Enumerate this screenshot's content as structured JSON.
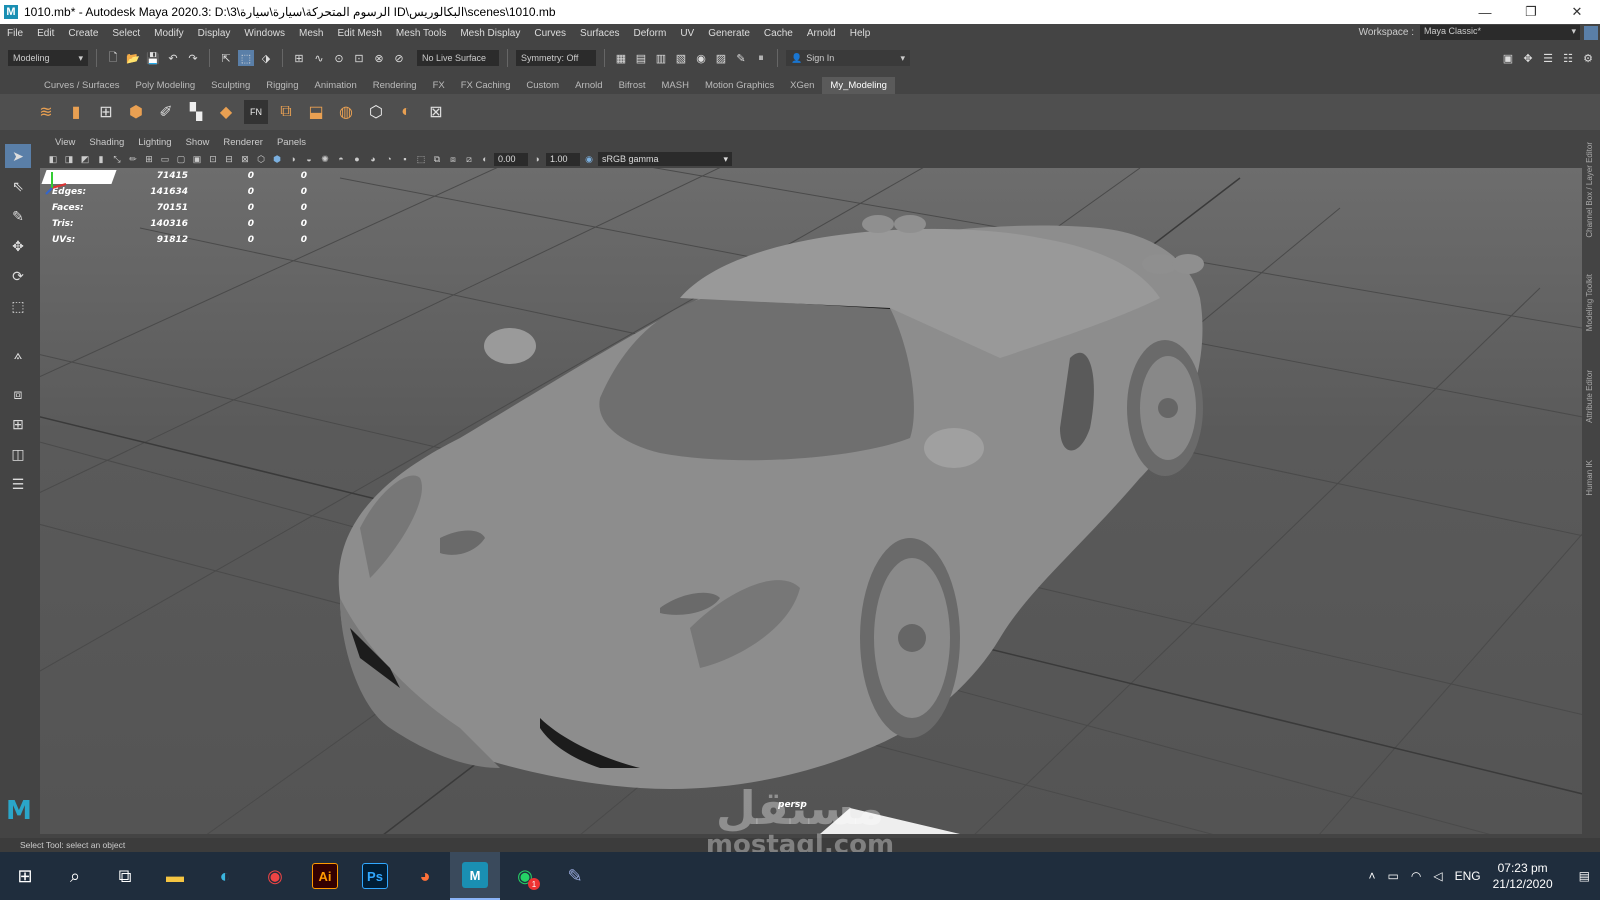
{
  "window": {
    "title": "1010.mb* - Autodesk Maya 2020.3: D:\\3\\الرسوم المتحركة\\سيارة\\سيارة ID\\البكالوريس\\scenes\\1010.mb",
    "logo": "M",
    "minimize": "—",
    "maximize": "❐",
    "close": "✕"
  },
  "menubar": {
    "items": [
      "File",
      "Edit",
      "Create",
      "Select",
      "Modify",
      "Display",
      "Windows",
      "Mesh",
      "Edit Mesh",
      "Mesh Tools",
      "Mesh Display",
      "Curves",
      "Surfaces",
      "Deform",
      "UV",
      "Generate",
      "Cache",
      "Arnold",
      "Help"
    ],
    "workspace_label": "Workspace :",
    "workspace_value": "Maya Classic*"
  },
  "statusline": {
    "menuset": "Modeling",
    "live_surface": "No Live Surface",
    "symmetry": "Symmetry: Off",
    "sign_in": "Sign In"
  },
  "shelf": {
    "tabs": [
      "Curves / Surfaces",
      "Poly Modeling",
      "Sculpting",
      "Rigging",
      "Animation",
      "Rendering",
      "FX",
      "FX Caching",
      "Custom",
      "Arnold",
      "Bifrost",
      "MASH",
      "Motion Graphics",
      "XGen",
      "My_Modeling"
    ],
    "active_tab": "My_Modeling"
  },
  "viewport": {
    "panel_menus": [
      "View",
      "Shading",
      "Lighting",
      "Show",
      "Renderer",
      "Panels"
    ],
    "exposure": "0.00",
    "gamma": "1.00",
    "color_space": "sRGB gamma",
    "camera_label": "persp"
  },
  "hud": {
    "rows": [
      {
        "label": "",
        "v1": "71415",
        "v2": "0",
        "v3": "0"
      },
      {
        "label": "Edges:",
        "v1": "141634",
        "v2": "0",
        "v3": "0"
      },
      {
        "label": "Faces:",
        "v1": "70151",
        "v2": "0",
        "v3": "0"
      },
      {
        "label": "Tris:",
        "v1": "140316",
        "v2": "0",
        "v3": "0"
      },
      {
        "label": "UVs:",
        "v1": "91812",
        "v2": "0",
        "v3": "0"
      }
    ]
  },
  "side_tabs": [
    "Channel Box / Layer Editor",
    "Modeling Toolkit",
    "Attribute Editor",
    "Human IK"
  ],
  "helpline": "Select Tool: select an object",
  "taskbar": {
    "illustrator": "Ai",
    "photoshop": "Ps",
    "maya": "M",
    "whatsapp_badge": "1",
    "language": "ENG",
    "time": "07:23 pm",
    "date": "21/12/2020"
  },
  "watermark": {
    "arabic": "مستقل",
    "latin": "mostaql.com"
  },
  "colors": {
    "maya_bg": "#444444",
    "accent_blue": "#5a7fa8",
    "taskbar": "#1f2d3d",
    "maya_logo": "#2aa6c9"
  }
}
